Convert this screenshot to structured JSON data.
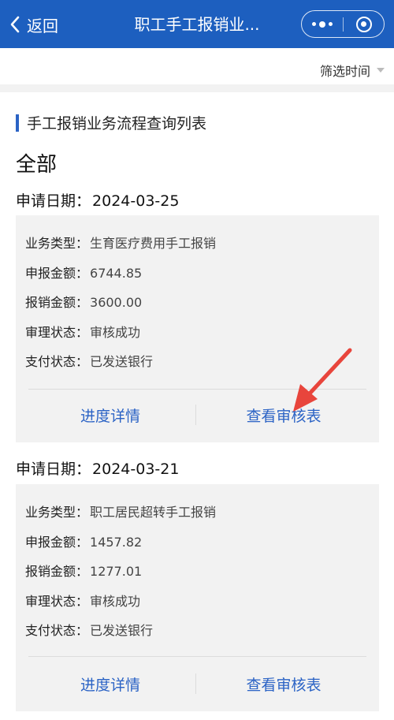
{
  "navbar": {
    "back_label": "返回",
    "title": "职工手工报销业...",
    "color": "#1d5fbf"
  },
  "filter": {
    "label": "筛选时间"
  },
  "section": {
    "title": "手工报销业务流程查询列表"
  },
  "group": {
    "title": "全部"
  },
  "records": [
    {
      "date_label": "申请日期：",
      "date": "2024-03-25",
      "fields": [
        {
          "label": "业务类型：",
          "value": "生育医疗费用手工报销"
        },
        {
          "label": "申报金额：",
          "value": "6744.85"
        },
        {
          "label": "报销金额：",
          "value": "3600.00"
        },
        {
          "label": "审理状态：",
          "value": "审核成功"
        },
        {
          "label": "支付状态：",
          "value": "已发送银行"
        }
      ],
      "actions": {
        "progress": "进度详情",
        "review_table": "查看审核表"
      }
    },
    {
      "date_label": "申请日期：",
      "date": "2024-03-21",
      "fields": [
        {
          "label": "业务类型：",
          "value": "职工居民超转手工报销"
        },
        {
          "label": "申报金额：",
          "value": "1457.82"
        },
        {
          "label": "报销金额：",
          "value": "1277.01"
        },
        {
          "label": "审理状态：",
          "value": "审核成功"
        },
        {
          "label": "支付状态：",
          "value": "已发送银行"
        }
      ],
      "actions": {
        "progress": "进度详情",
        "review_table": "查看审核表"
      }
    }
  ],
  "colors": {
    "accent": "#2b63c5",
    "annotation_arrow": "#e8453c",
    "card_bg": "#f2f2f2"
  }
}
